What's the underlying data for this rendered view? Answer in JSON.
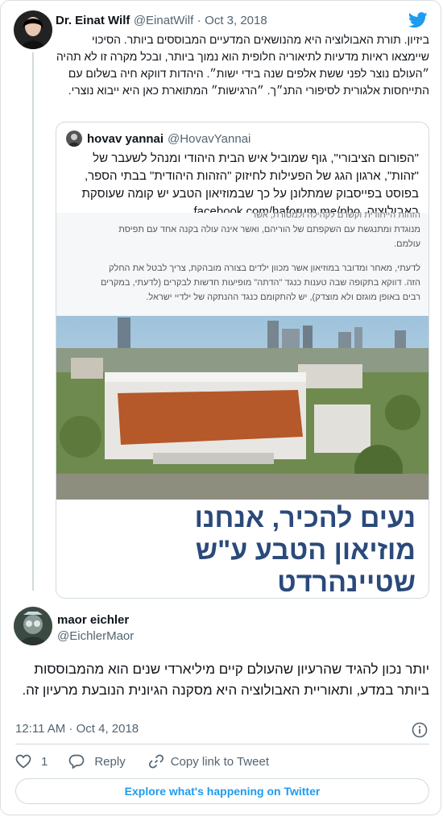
{
  "parent_tweet": {
    "author_name": "Dr. Einat Wilf",
    "author_handle": "@EinatWilf",
    "date": "Oct 3, 2018",
    "text": "ביזיון. תורת האבולוציה היא מהנושאים המדעיים המבוססים ביותר. הסיכוי שיימצאו ראיות מדעיות לתיאוריה חלופית הוא נמוך ביותר, ובכל מקרה זו לא תהיה ״העולם נוצר לפני ששת אלפים שנה בידי ישות״. היהדות דווקא חיה בשלום עם התייחסות אלגורית לסיפורי התנ״ך. ״הרגישות״ המתוארת כאן היא ייבוא נוצרי."
  },
  "quoted_tweet": {
    "author_name": "hovav yannai",
    "author_handle": "@HovavYannai",
    "text": "\"הפורום הציבורי\", גוף שמוביל איש הבית היהודי ומנהל לשעבר של \"זהות\", ארגון הגג של הפעילות לחיזוק \"הזהות היהודית\" בבתי הספר, בפוסט בפייסבוק שמתלונן על כך שבמוזיאון הטבע יש קומה שעוסקת באבולוציה. facebook.com/haforum.me/pho…",
    "image": {
      "text_lines": [
        "הזהות הייחודית וקשרם לקהילה ולמסורת, אשר",
        "מנוגדת ומתנגשת עם השקפתם של הוריהם, ואשר אינה עולה בקנה אחד עם תפיסת",
        "עולמם.",
        "לדעתי, מאחר ומדובר במוזיאון אשר מכוון ילדים בצורה מובהקת, צריך לבטל את החלק",
        "הזה. דווקא בתקופה שבה טענות כנגד \"הדתה\" מופיעות חדשות לבקרים (לדעתי, במקרים",
        "רבים באופן מוגזם ולא מוצדק), יש להתקומם כנגד ההנתקה של ילדיי ישראל."
      ],
      "banner_line_1": "נעים להכיר, אנחנו",
      "banner_line_2": "מוזיאון הטבע ע\"ש",
      "banner_line_3": "שטיינהרדט"
    }
  },
  "main_tweet": {
    "author_name": "maor eichler",
    "author_handle": "@EichlerMaor",
    "text": "יותר נכון להגיד שהרעיון שהעולם קיים מיליארדי שנים הוא מהמבוססות ביותר במדע, ותאוריית האבולוציה היא מסקנה הגיונית הנובעת מרעיון זה.",
    "timestamp": "12:11 AM · Oct 4, 2018"
  },
  "actions": {
    "like_count": "1",
    "reply_label": "Reply",
    "copy_label": "Copy link to Tweet"
  },
  "explore_label": "Explore what's happening on Twitter",
  "colors": {
    "twitter_blue": "#1d9bf0",
    "secondary_text": "#536471",
    "border": "#cfd9de",
    "museum_orange": "#b5582a",
    "banner_text": "#2b4a7a"
  }
}
